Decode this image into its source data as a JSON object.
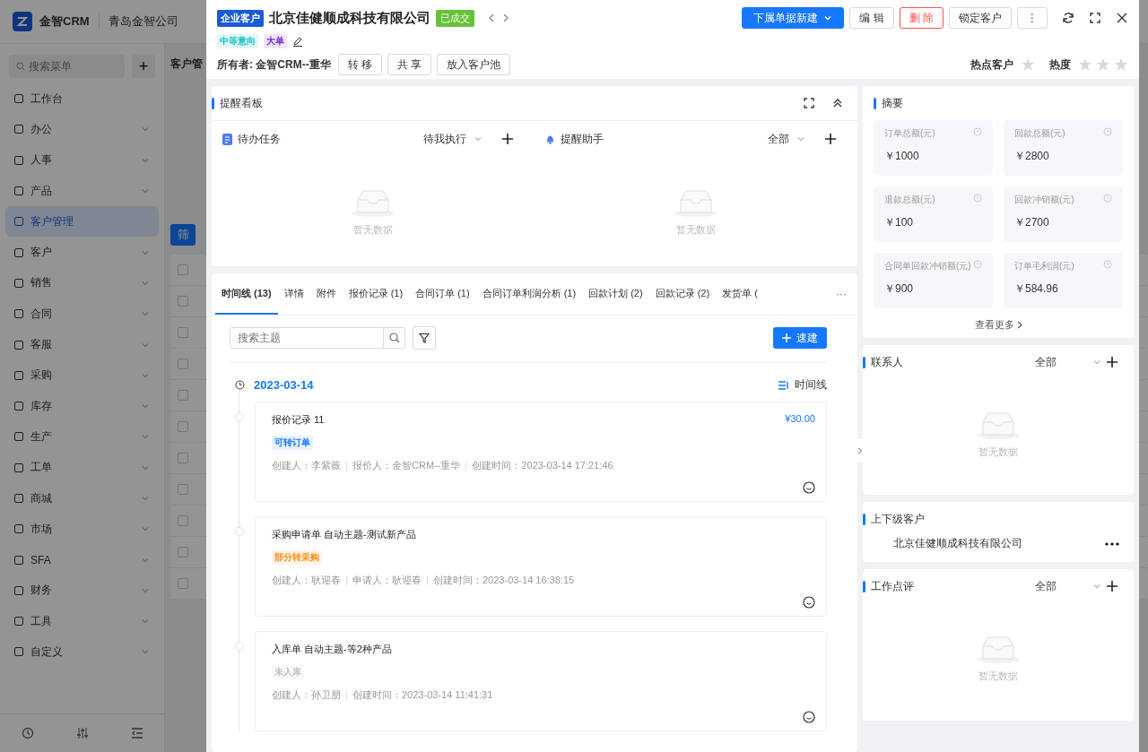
{
  "app": {
    "logo_text": "金智CRM",
    "company": "青岛金智公司"
  },
  "sidebar": {
    "search_placeholder": "搜索菜单",
    "add": "+",
    "items": [
      {
        "label": "工作台",
        "kind": "link",
        "selected": false
      },
      {
        "label": "办公",
        "kind": "group",
        "selected": false
      },
      {
        "label": "人事",
        "kind": "group",
        "selected": false
      },
      {
        "label": "产品",
        "kind": "group",
        "selected": false
      },
      {
        "label": "客户管理",
        "kind": "link",
        "selected": true
      },
      {
        "label": "客户",
        "kind": "group",
        "selected": false
      },
      {
        "label": "销售",
        "kind": "group",
        "selected": false
      },
      {
        "label": "合同",
        "kind": "group",
        "selected": false
      },
      {
        "label": "客服",
        "kind": "group",
        "selected": false
      },
      {
        "label": "采购",
        "kind": "group",
        "selected": false
      },
      {
        "label": "库存",
        "kind": "group",
        "selected": false
      },
      {
        "label": "生产",
        "kind": "group",
        "selected": false
      },
      {
        "label": "工单",
        "kind": "group",
        "selected": false
      },
      {
        "label": "商城",
        "kind": "group",
        "selected": false
      },
      {
        "label": "市场",
        "kind": "group",
        "selected": false
      },
      {
        "label": "SFA",
        "kind": "group",
        "selected": false
      },
      {
        "label": "财务",
        "kind": "group",
        "selected": false
      },
      {
        "label": "工具",
        "kind": "group",
        "selected": false
      },
      {
        "label": "自定义",
        "kind": "group",
        "selected": false
      }
    ]
  },
  "backdrop": {
    "page_title": "客户管",
    "filter_button": "筛",
    "rows": [
      {
        "checked": false
      },
      {
        "checked": false
      },
      {
        "checked": false
      },
      {
        "checked": false
      },
      {
        "checked": false
      },
      {
        "checked": false
      },
      {
        "checked": false
      },
      {
        "checked": false
      },
      {
        "checked": false
      },
      {
        "checked": false
      },
      {
        "checked": false
      }
    ]
  },
  "drawer": {
    "header": {
      "type_tag": "企业客户",
      "name": "北京佳健顺成科技有限公司",
      "status": "已成交",
      "actions": [
        {
          "label": "下属单据新建",
          "kind": "primary"
        },
        {
          "label": "编 辑",
          "kind": "default"
        },
        {
          "label": "删 除",
          "kind": "danger"
        },
        {
          "label": "锁定客户",
          "kind": "default"
        },
        {
          "label": "⋮",
          "kind": "default"
        }
      ],
      "tags": [
        {
          "text": "中等意向",
          "color": "#13c2c2"
        },
        {
          "text": "大单",
          "color": "#722ed1"
        }
      ],
      "owner_label": "所有者:",
      "owner": "金智CRM--重华",
      "owner_buttons": [
        "转 移",
        "共 享",
        "放入客户池"
      ],
      "ratings": [
        {
          "kind": "hot",
          "label": "热点客户",
          "on": false
        },
        {
          "kind": "heat",
          "label": "热度",
          "stars": 0
        }
      ]
    },
    "reminder_board": {
      "title": "提醒看板",
      "panels": [
        {
          "kind": "task",
          "title": "待办任务",
          "filter": "待我执行",
          "empty": "暂无数据"
        },
        {
          "kind": "bell",
          "title": "提醒助手",
          "filter": "全部",
          "empty": "暂无数据"
        }
      ]
    },
    "detail_tabs": [
      {
        "label": "时间线 (13)",
        "selected": true
      },
      {
        "label": "详情",
        "selected": false
      },
      {
        "label": "附件",
        "selected": false
      },
      {
        "label": "报价记录 (1)",
        "selected": false
      },
      {
        "label": "合同订单 (1)",
        "selected": false
      },
      {
        "label": "合同订单利润分析 (1)",
        "selected": false
      },
      {
        "label": "回款计划 (2)",
        "selected": false
      },
      {
        "label": "回款记录 (2)",
        "selected": false
      },
      {
        "label": "发货单 (",
        "selected": false
      }
    ],
    "tabs_more": "···",
    "timeline": {
      "search_placeholder": "搜索主题",
      "quick_create": "速建",
      "date": "2023-03-14",
      "view_toggle": "时间线",
      "entries": [
        {
          "title": "报价记录 11",
          "amount": "¥30.00",
          "tag": {
            "text": "可转订单",
            "color": "#1677ff"
          },
          "meta": [
            "创建人：李紫薇",
            "报价人：金智CRM--重华",
            "创建时间：2023-03-14 17:21:46"
          ]
        },
        {
          "title": "采购申请单 自动主题-测试新产品",
          "tag": {
            "text": "部分转采购",
            "color": "#fa8c16"
          },
          "meta": [
            "创建人：耿迎春",
            "申请人：耿迎春",
            "创建时间：2023-03-14 16:38:15"
          ]
        },
        {
          "title": "入库单 自动主题-等2种产品",
          "tag": {
            "text": "未入库",
            "color": "#bfbfbf"
          },
          "meta": [
            "创建人：孙卫朋",
            "创建时间：2023-03-14 11:41:31"
          ]
        }
      ]
    },
    "summary": {
      "title": "摘要",
      "metrics": [
        {
          "label": "订单总额(元)",
          "value": "￥1000"
        },
        {
          "label": "回款总额(元)",
          "value": "￥2800"
        },
        {
          "label": "退款总额(元)",
          "value": "￥100"
        },
        {
          "label": "回款冲销额(元)",
          "value": "￥2700"
        },
        {
          "label": "合同单回款冲销额(元)",
          "value": "￥900"
        },
        {
          "label": "订单毛利润(元)",
          "value": "￥584.96"
        }
      ],
      "more": "查看更多"
    },
    "contacts": {
      "title": "联系人",
      "filter": "全部",
      "empty": "暂无数据"
    },
    "hierarchy": {
      "title": "上下级客户",
      "item": "北京佳健顺成科技有限公司"
    },
    "reviews": {
      "title": "工作点评",
      "filter": "全部",
      "empty": "暂无数据"
    }
  }
}
